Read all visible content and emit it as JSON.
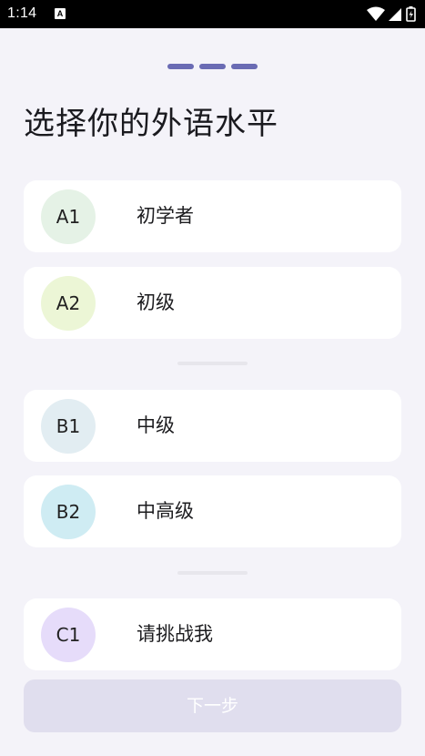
{
  "status_bar": {
    "time": "1:14",
    "notification_letter": "A",
    "icons": [
      "wifi-icon",
      "signal-icon",
      "battery-icon"
    ]
  },
  "progress": {
    "steps": 3,
    "active_color": "#6a6bb4"
  },
  "title": "选择你的外语水平",
  "levels": [
    {
      "code": "A1",
      "label": "初学者",
      "color": "#e5f2e6"
    },
    {
      "code": "A2",
      "label": "初级",
      "color": "#ecf6d6"
    },
    {
      "code": "B1",
      "label": "中级",
      "color": "#e2edf2"
    },
    {
      "code": "B2",
      "label": "中高级",
      "color": "#cfecf3"
    },
    {
      "code": "C1",
      "label": "请挑战我",
      "color": "#e6dcfa"
    }
  ],
  "next_button": {
    "label": "下一步",
    "enabled": false
  }
}
